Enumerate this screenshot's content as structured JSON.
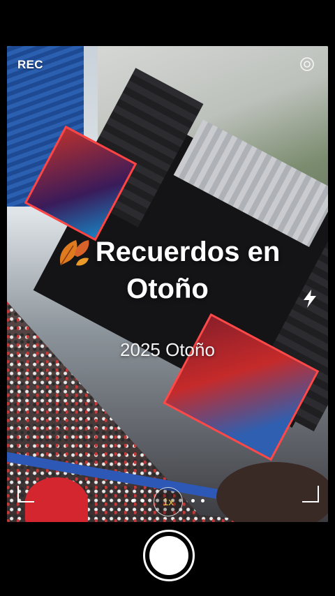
{
  "camera": {
    "rec_label": "REC",
    "title_line1": "Recuerdos en",
    "title_line2": "Otoño",
    "subtitle": "2025 Otoño",
    "zoom_label": "1x"
  },
  "icons": {
    "settings": "settings-icon",
    "flash": "flash-icon",
    "leaf": "autumn-leaf-icon",
    "shutter": "shutter-button"
  },
  "colors": {
    "accent_zoom": "#f1c94b",
    "leaf_orange": "#e07a1f"
  }
}
